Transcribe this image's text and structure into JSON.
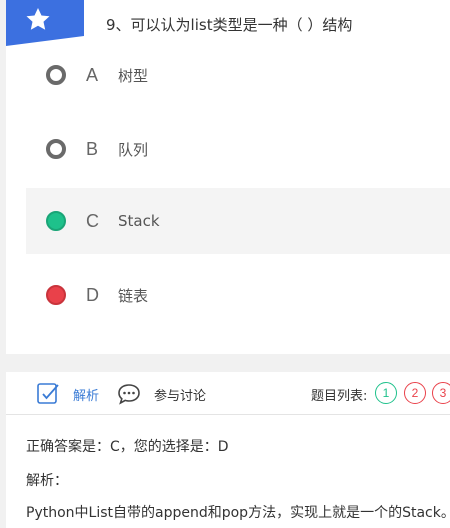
{
  "question": {
    "text": "9、可以认为list类型是一种（  ）结构",
    "options": [
      {
        "letter": "A",
        "text": "树型",
        "state": "unselected"
      },
      {
        "letter": "B",
        "text": "队列",
        "state": "unselected"
      },
      {
        "letter": "C",
        "text": "Stack",
        "state": "correct"
      },
      {
        "letter": "D",
        "text": "链表",
        "state": "wrong"
      }
    ]
  },
  "analysis": {
    "tabs": {
      "analysis_label": "解析",
      "discuss_label": "参与讨论"
    },
    "question_list": {
      "label": "题目列表:",
      "items": [
        "1",
        "2",
        "3"
      ]
    },
    "answer_line": "正确答案是：C，您的选择是：D",
    "analysis_heading": "解析：",
    "analysis_text": "Python中List自带的append和pop方法，实现上就是一个的Stack。"
  },
  "colors": {
    "accent": "#3a7bd5",
    "correct": "#1ec18b",
    "wrong": "#e9414a"
  }
}
